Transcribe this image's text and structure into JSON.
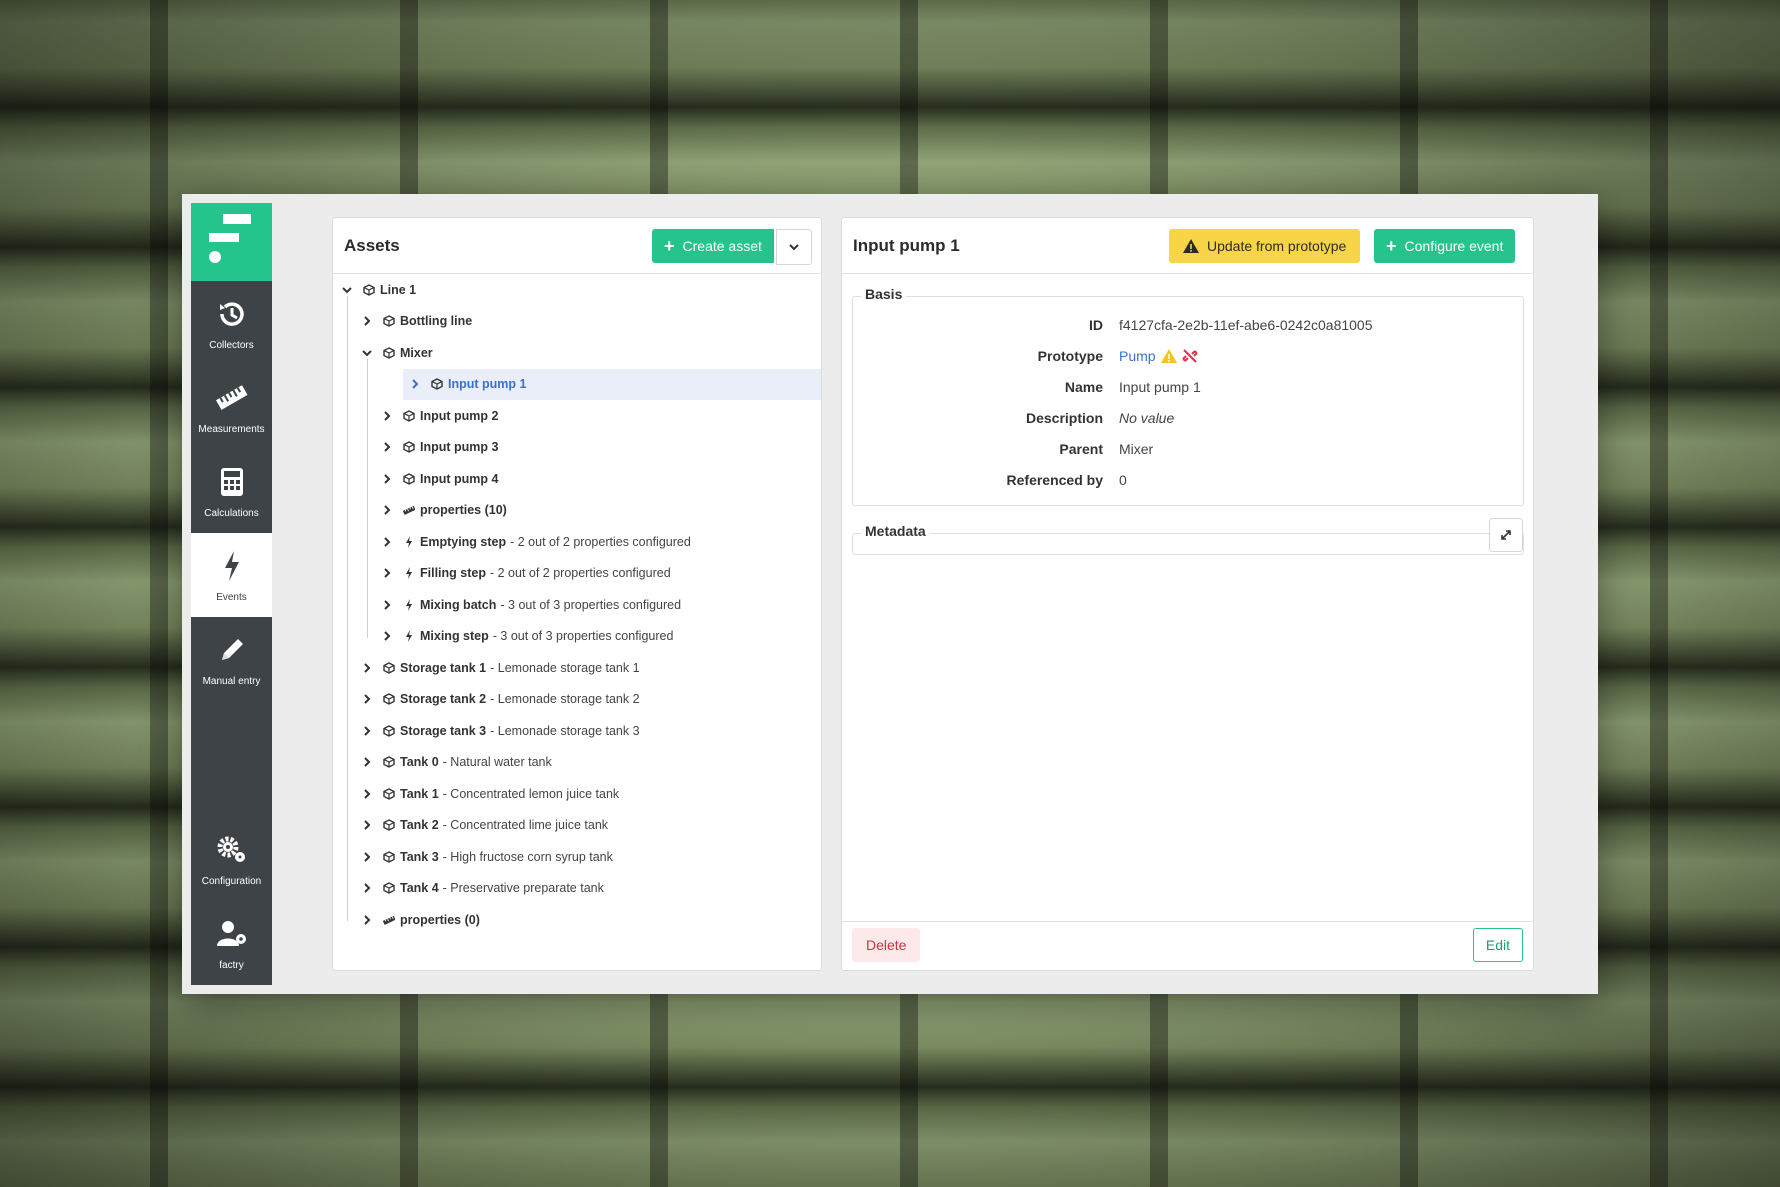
{
  "sidebar": {
    "items": [
      {
        "label": "Collectors",
        "icon": "history-icon"
      },
      {
        "label": "Measurements",
        "icon": "ruler-icon"
      },
      {
        "label": "Calculations",
        "icon": "calculator-icon"
      },
      {
        "label": "Events",
        "icon": "bolt-icon"
      },
      {
        "label": "Manual entry",
        "icon": "pencil-icon"
      }
    ],
    "bottom": [
      {
        "label": "Configuration",
        "icon": "gears-icon"
      },
      {
        "label": "factry",
        "icon": "user-gear-icon"
      }
    ]
  },
  "assets": {
    "title": "Assets",
    "create_label": "Create asset",
    "tree": [
      {
        "name": "Line 1",
        "desc": "",
        "icon": "cube",
        "expanded": true
      },
      {
        "name": "Bottling line",
        "desc": "",
        "icon": "cube"
      },
      {
        "name": "Mixer",
        "desc": "",
        "icon": "cube",
        "expanded": true
      },
      {
        "name": "Input pump 1",
        "desc": "",
        "icon": "cube",
        "selected": true
      },
      {
        "name": "Input pump 2",
        "desc": "",
        "icon": "cube"
      },
      {
        "name": "Input pump 3",
        "desc": "",
        "icon": "cube"
      },
      {
        "name": "Input pump 4",
        "desc": "",
        "icon": "cube"
      },
      {
        "name": "properties (10)",
        "desc": "",
        "icon": "ruler"
      },
      {
        "name": "Emptying step",
        "desc": "- 2 out of 2 properties configured",
        "icon": "bolt"
      },
      {
        "name": "Filling step",
        "desc": "- 2 out of 2 properties configured",
        "icon": "bolt"
      },
      {
        "name": "Mixing batch",
        "desc": "- 3 out of 3 properties configured",
        "icon": "bolt"
      },
      {
        "name": "Mixing step",
        "desc": "- 3 out of 3 properties configured",
        "icon": "bolt"
      },
      {
        "name": "Storage tank 1",
        "desc": "- Lemonade storage tank 1",
        "icon": "cube"
      },
      {
        "name": "Storage tank 2",
        "desc": "- Lemonade storage tank 2",
        "icon": "cube"
      },
      {
        "name": "Storage tank 3",
        "desc": "- Lemonade storage tank 3",
        "icon": "cube"
      },
      {
        "name": "Tank 0",
        "desc": "- Natural water tank",
        "icon": "cube"
      },
      {
        "name": "Tank 1",
        "desc": "- Concentrated lemon juice tank",
        "icon": "cube"
      },
      {
        "name": "Tank 2",
        "desc": "- Concentrated lime juice tank",
        "icon": "cube"
      },
      {
        "name": "Tank 3",
        "desc": "- High fructose corn syrup tank",
        "icon": "cube"
      },
      {
        "name": "Tank 4",
        "desc": "- Preservative preparate tank",
        "icon": "cube"
      },
      {
        "name": "properties (0)",
        "desc": "",
        "icon": "ruler"
      }
    ]
  },
  "detail": {
    "title": "Input pump 1",
    "update_label": "Update from prototype",
    "configure_label": "Configure event",
    "basis": {
      "legend": "Basis",
      "fields": [
        {
          "key": "ID",
          "value": "f4127cfa-2e2b-11ef-abe6-0242c0a81005"
        },
        {
          "key": "Prototype",
          "value": "Pump"
        },
        {
          "key": "Name",
          "value": "Input pump 1"
        },
        {
          "key": "Description",
          "value": "No value"
        },
        {
          "key": "Parent",
          "value": "Mixer"
        },
        {
          "key": "Referenced by",
          "value": "0"
        }
      ]
    },
    "metadata_legend": "Metadata",
    "delete_label": "Delete",
    "edit_label": "Edit"
  },
  "colors": {
    "accent": "#25c48c",
    "sidebar": "#3d4347",
    "warning": "#f7d547",
    "danger": "#d0303f",
    "link": "#3b6fd0"
  }
}
